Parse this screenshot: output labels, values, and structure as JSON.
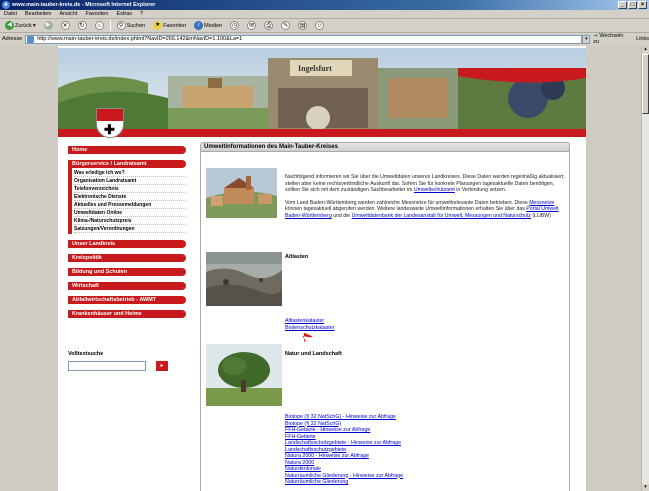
{
  "window": {
    "title": "www.main-tauber-kreis.de - Microsoft Internet Explorer",
    "min": "_",
    "max": "□",
    "close": "×"
  },
  "menu": [
    "Datei",
    "Bearbeiten",
    "Ansicht",
    "Favoriten",
    "Extras",
    "?"
  ],
  "toolbar": {
    "back": "Zurück",
    "search": "Suchen",
    "favorites": "Favoriten",
    "media": "Medien"
  },
  "address": {
    "label": "Adresse",
    "url": "http://www.main-tauber-kreis.de/index.phtml?NavID=266.142&mNavID=1.100&La=1",
    "go": "Wechseln zu",
    "links": "Links"
  },
  "site": {
    "banner_sign": "Ingelsfurt",
    "nav": [
      {
        "label": "Home"
      },
      {
        "label": "Bürgerservice / Landratsamt",
        "sub": [
          "Was erledige ich wo?",
          "Organisation Landratsamt",
          "Telefonverzeichnis",
          "Elektronische Dienste",
          "Aktuelles und Pressemeldungen",
          "Umweltdaten Online",
          "Klima-/Naturschutzpreis",
          "Satzungen/Verordnungen"
        ]
      },
      {
        "label": "Unser Landkreis"
      },
      {
        "label": "Kreispolitik"
      },
      {
        "label": "Bildung und Schulen"
      },
      {
        "label": "Wirtschaft"
      },
      {
        "label": "Abfallwirtschaftsbetrieb - AWMT"
      },
      {
        "label": "Krankenhäuser und Heime"
      }
    ],
    "search_label": "Volltextsuche",
    "search_go": "▸"
  },
  "content": {
    "header": "Umweltinformationen des Main-Tauber-Kreises",
    "intro_p1_a": "Nachfolgend informieren wir Sie über die Umweltdaten unseres Landkreises. Diese Daten werden regelmäßig aktualisiert, stellen aber keine rechtsverbindliche Auskunft dar. Sofern Sie für konkrete Planungen tagesaktuelle Daten benötigen, sollten Sie sich mit dem zuständigen Sachbearbeiter im ",
    "intro_p1_link": "Umweltschutzamt",
    "intro_p1_b": " in Verbindung setzen.",
    "intro_p2_a": "Vom Land Baden-Württemberg werden zahlreiche Messnetze für umweltrelevante Daten betrieben. Diese ",
    "intro_p2_link1": "Messnetze",
    "intro_p2_b": " können tagesaktuell abgerufen werden. Weitere landesweite Umweltinformationen erhalten Sie über das ",
    "intro_p2_link2": "Portal Umwelt Baden-Württemberg",
    "intro_p2_c": " und die ",
    "intro_p2_link3": "Umweltdatenbank der Landesanstalt für Umwelt, Messungen und Naturschutz",
    "intro_p2_d": " (LUBW)",
    "sections": [
      {
        "title": "Altlasten",
        "links": [
          "Altlastenkataster",
          "Bodenschutzkataster"
        ]
      },
      {
        "title": "Natur und Landschaft",
        "links": [
          "Biotope (§ 32 NatSchG) - Hinweise zur Abfrage",
          "Biotope (§ 32 NatSchG)",
          "FFH-Gebiete - Hinweise zur Abfrage",
          "FFH-Gebiete",
          "Landschaftsschutzgebiete - Hinweise zur Abfrage",
          "Landschaftsschutzgebiete",
          "Natura 2000 - Hinweise zur Abfrage",
          "Natura 2000",
          "Naturdenkmale",
          "Naturräumliche Gliederung - Hinweise zur Abfrage",
          "Naturräumliche Gliederung"
        ]
      }
    ]
  },
  "colors": {
    "brand_red": "#c8191c",
    "link": "#0000cc",
    "titlebar": "#0a246a"
  }
}
